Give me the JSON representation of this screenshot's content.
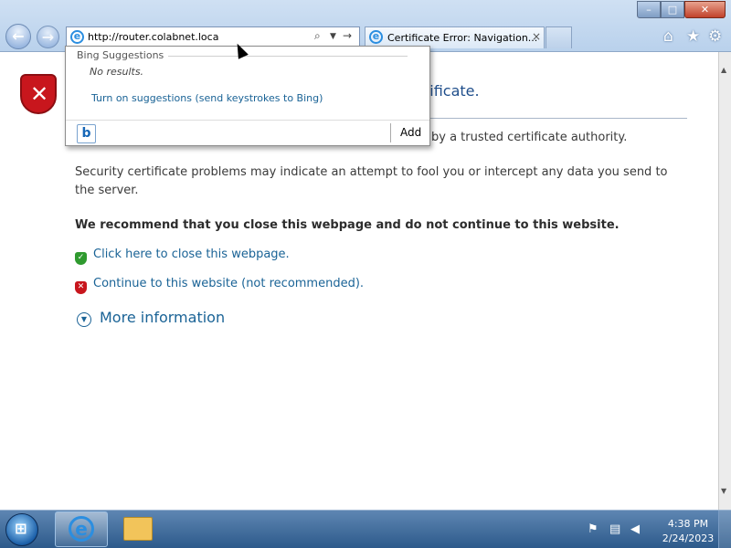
{
  "browser": {
    "address": "http://router.colabnet.loca",
    "tab_title": "Certificate Error: Navigation...",
    "tab_close": "×",
    "caption": {
      "min": "–",
      "max": "□",
      "close": "✕"
    },
    "nav": {
      "back": "←",
      "forward": "→"
    },
    "toolbar": {
      "home": "⌂",
      "favorites": "★",
      "tools": "⚙"
    }
  },
  "suggestions": {
    "header": "Bing Suggestions",
    "no_results": "No results.",
    "turn_on": "Turn on suggestions (send keystrokes to Bing)",
    "provider_icon": "b",
    "add_label": "Add"
  },
  "page": {
    "heading_visible": "tificate.",
    "para1_visible": "by a trusted certificate authority.",
    "para2": "Security certificate problems may indicate an attempt to fool you or intercept any data you send to the server.",
    "recommend": "We recommend that you close this webpage and do not continue to this website.",
    "close_link": "Click here to close this webpage.",
    "continue_link": "Continue to this website (not recommended).",
    "more_info": "More information"
  },
  "taskbar": {
    "time": "4:38 PM",
    "date": "2/24/2023"
  },
  "colors": {
    "link": "#1a6396",
    "error_red": "#c8161d",
    "safe_green": "#2f9a2f"
  }
}
